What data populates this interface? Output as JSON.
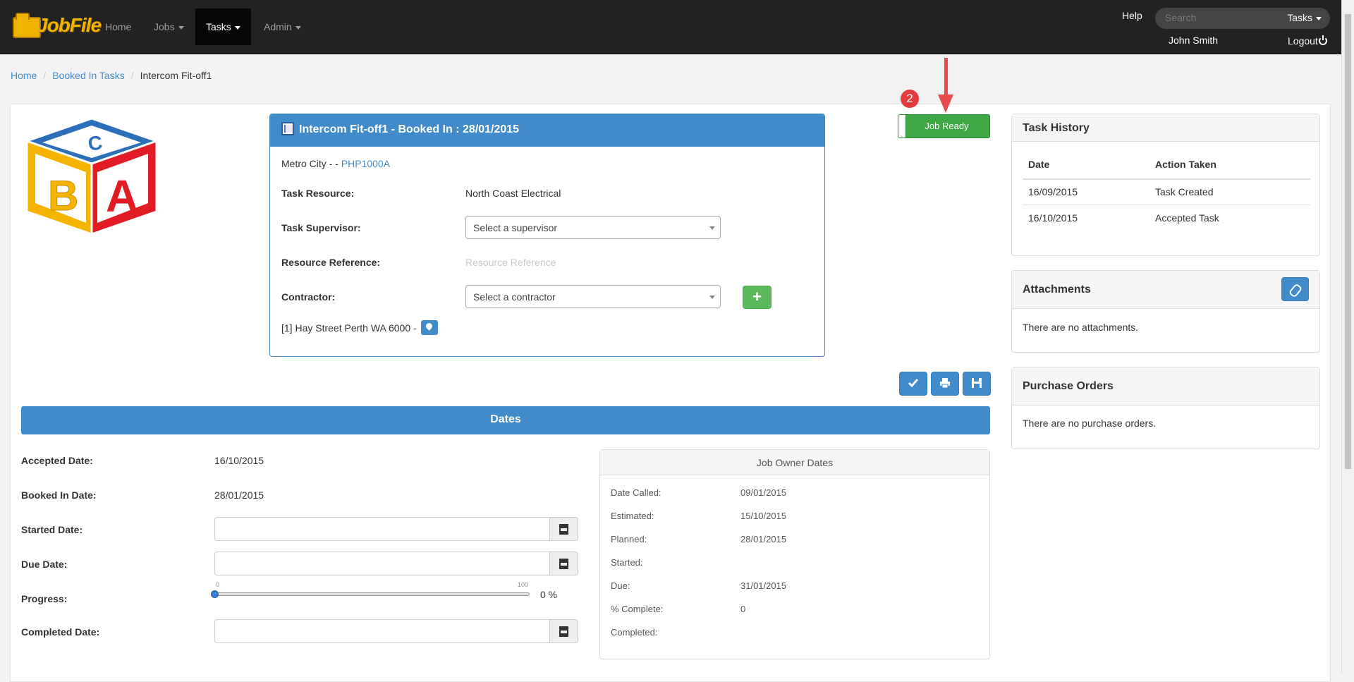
{
  "nav": {
    "brand": "JobFile",
    "items": [
      {
        "label": "Home"
      },
      {
        "label": "Jobs"
      },
      {
        "label": "Tasks"
      },
      {
        "label": "Admin"
      }
    ],
    "help": "Help",
    "search_placeholder": "Search",
    "search_scope": "Tasks",
    "user": "John Smith",
    "logout": "Logout"
  },
  "breadcrumb": [
    "Home",
    "Booked In Tasks",
    "Intercom Fit-off1"
  ],
  "task": {
    "title": "Intercom Fit-off1 - Booked In : 28/01/2015",
    "location_prefix": "Metro City - - ",
    "location_link": "PHP1000A",
    "resource_label": "Task Resource:",
    "resource_value": "North Coast Electrical",
    "supervisor_label": "Task Supervisor:",
    "supervisor_placeholder": "Select a supervisor",
    "reference_label": "Resource Reference:",
    "reference_placeholder": "Resource Reference",
    "contractor_label": "Contractor:",
    "contractor_placeholder": "Select a contractor",
    "add_contractor": "+",
    "address": "[1] Hay Street Perth WA 6000 -"
  },
  "annotation": {
    "step": "2"
  },
  "job_ready": "Job Ready",
  "dates": {
    "title": "Dates",
    "accepted_label": "Accepted Date:",
    "accepted_value": "16/10/2015",
    "booked_label": "Booked In Date:",
    "booked_value": "28/01/2015",
    "started_label": "Started Date:",
    "due_label": "Due Date:",
    "progress_label": "Progress:",
    "progress_min": "0",
    "progress_max": "100",
    "progress_value": 0,
    "progress_text": "0 %",
    "completed_label": "Completed Date:"
  },
  "owner_dates": {
    "title": "Job Owner Dates",
    "rows": [
      {
        "label": "Date Called:",
        "value": "09/01/2015"
      },
      {
        "label": "Estimated:",
        "value": "15/10/2015"
      },
      {
        "label": "Planned:",
        "value": "28/01/2015"
      },
      {
        "label": "Started:",
        "value": ""
      },
      {
        "label": "Due:",
        "value": "31/01/2015"
      },
      {
        "label": "% Complete:",
        "value": "0"
      },
      {
        "label": "Completed:",
        "value": ""
      }
    ]
  },
  "task_history": {
    "title": "Task History",
    "columns": [
      "Date",
      "Action Taken"
    ],
    "rows": [
      {
        "date": "16/09/2015",
        "action": "Task Created"
      },
      {
        "date": "16/10/2015",
        "action": "Accepted Task"
      }
    ]
  },
  "attachments": {
    "title": "Attachments",
    "empty": "There are no attachments."
  },
  "purchase_orders": {
    "title": "Purchase Orders",
    "empty": "There are no purchase orders."
  },
  "colors": {
    "primary": "#428bca",
    "success": "#3fa744",
    "navbar": "#222222",
    "annotation": "#e33c3c"
  },
  "icons": {
    "task": "document-icon",
    "map": "map-marker-icon",
    "accept": "check-icon",
    "print": "print-icon",
    "save": "save-icon",
    "calendar": "calendar-icon",
    "attach": "paperclip-icon"
  }
}
